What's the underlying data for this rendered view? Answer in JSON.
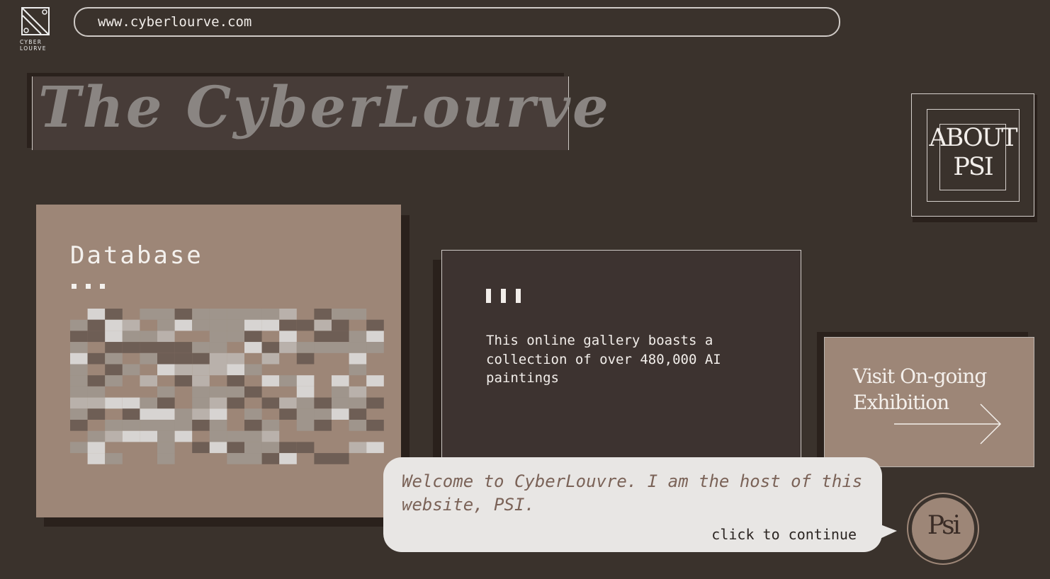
{
  "logo": {
    "line1": "CYBER",
    "line2": "LOURVE"
  },
  "address_bar": {
    "url": "www.cyberlourve.com"
  },
  "header": {
    "title": "The CyberLourve"
  },
  "about": {
    "label": "ABOUT\nPSI"
  },
  "database": {
    "title": "Database"
  },
  "intro_card": {
    "text": "This online gallery boasts a collection of over 480,000 AI paintings"
  },
  "exhibition": {
    "label": "Visit On-going Exhibition"
  },
  "dialog": {
    "message": "Welcome to CyberLouvre. I am the host of this website, PSI.",
    "continue_label": "click to continue"
  },
  "host": {
    "avatar_label": "Psi"
  },
  "colors": {
    "background": "#3a322c",
    "panel": "#9d8677",
    "card": "#3d3330",
    "bubble": "#e8e6e4",
    "mosaic_palette": [
      "#6e5e55",
      "#9f958c",
      "#b9b1ab",
      "#d7d4d2"
    ]
  }
}
